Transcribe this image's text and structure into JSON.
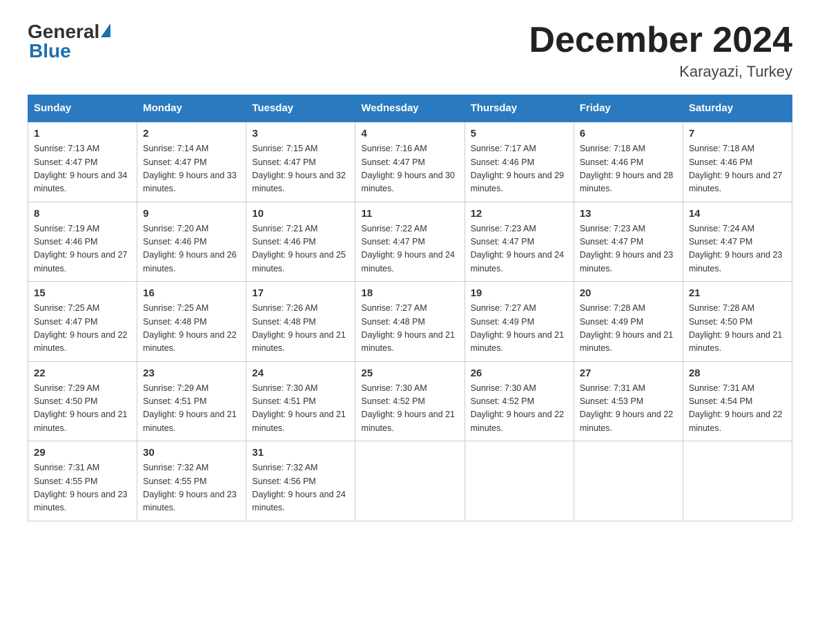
{
  "logo": {
    "general": "General",
    "blue": "Blue"
  },
  "title": "December 2024",
  "location": "Karayazi, Turkey",
  "days_of_week": [
    "Sunday",
    "Monday",
    "Tuesday",
    "Wednesday",
    "Thursday",
    "Friday",
    "Saturday"
  ],
  "weeks": [
    [
      {
        "day": "1",
        "sunrise": "7:13 AM",
        "sunset": "4:47 PM",
        "daylight": "9 hours and 34 minutes."
      },
      {
        "day": "2",
        "sunrise": "7:14 AM",
        "sunset": "4:47 PM",
        "daylight": "9 hours and 33 minutes."
      },
      {
        "day": "3",
        "sunrise": "7:15 AM",
        "sunset": "4:47 PM",
        "daylight": "9 hours and 32 minutes."
      },
      {
        "day": "4",
        "sunrise": "7:16 AM",
        "sunset": "4:47 PM",
        "daylight": "9 hours and 30 minutes."
      },
      {
        "day": "5",
        "sunrise": "7:17 AM",
        "sunset": "4:46 PM",
        "daylight": "9 hours and 29 minutes."
      },
      {
        "day": "6",
        "sunrise": "7:18 AM",
        "sunset": "4:46 PM",
        "daylight": "9 hours and 28 minutes."
      },
      {
        "day": "7",
        "sunrise": "7:18 AM",
        "sunset": "4:46 PM",
        "daylight": "9 hours and 27 minutes."
      }
    ],
    [
      {
        "day": "8",
        "sunrise": "7:19 AM",
        "sunset": "4:46 PM",
        "daylight": "9 hours and 27 minutes."
      },
      {
        "day": "9",
        "sunrise": "7:20 AM",
        "sunset": "4:46 PM",
        "daylight": "9 hours and 26 minutes."
      },
      {
        "day": "10",
        "sunrise": "7:21 AM",
        "sunset": "4:46 PM",
        "daylight": "9 hours and 25 minutes."
      },
      {
        "day": "11",
        "sunrise": "7:22 AM",
        "sunset": "4:47 PM",
        "daylight": "9 hours and 24 minutes."
      },
      {
        "day": "12",
        "sunrise": "7:23 AM",
        "sunset": "4:47 PM",
        "daylight": "9 hours and 24 minutes."
      },
      {
        "day": "13",
        "sunrise": "7:23 AM",
        "sunset": "4:47 PM",
        "daylight": "9 hours and 23 minutes."
      },
      {
        "day": "14",
        "sunrise": "7:24 AM",
        "sunset": "4:47 PM",
        "daylight": "9 hours and 23 minutes."
      }
    ],
    [
      {
        "day": "15",
        "sunrise": "7:25 AM",
        "sunset": "4:47 PM",
        "daylight": "9 hours and 22 minutes."
      },
      {
        "day": "16",
        "sunrise": "7:25 AM",
        "sunset": "4:48 PM",
        "daylight": "9 hours and 22 minutes."
      },
      {
        "day": "17",
        "sunrise": "7:26 AM",
        "sunset": "4:48 PM",
        "daylight": "9 hours and 21 minutes."
      },
      {
        "day": "18",
        "sunrise": "7:27 AM",
        "sunset": "4:48 PM",
        "daylight": "9 hours and 21 minutes."
      },
      {
        "day": "19",
        "sunrise": "7:27 AM",
        "sunset": "4:49 PM",
        "daylight": "9 hours and 21 minutes."
      },
      {
        "day": "20",
        "sunrise": "7:28 AM",
        "sunset": "4:49 PM",
        "daylight": "9 hours and 21 minutes."
      },
      {
        "day": "21",
        "sunrise": "7:28 AM",
        "sunset": "4:50 PM",
        "daylight": "9 hours and 21 minutes."
      }
    ],
    [
      {
        "day": "22",
        "sunrise": "7:29 AM",
        "sunset": "4:50 PM",
        "daylight": "9 hours and 21 minutes."
      },
      {
        "day": "23",
        "sunrise": "7:29 AM",
        "sunset": "4:51 PM",
        "daylight": "9 hours and 21 minutes."
      },
      {
        "day": "24",
        "sunrise": "7:30 AM",
        "sunset": "4:51 PM",
        "daylight": "9 hours and 21 minutes."
      },
      {
        "day": "25",
        "sunrise": "7:30 AM",
        "sunset": "4:52 PM",
        "daylight": "9 hours and 21 minutes."
      },
      {
        "day": "26",
        "sunrise": "7:30 AM",
        "sunset": "4:52 PM",
        "daylight": "9 hours and 22 minutes."
      },
      {
        "day": "27",
        "sunrise": "7:31 AM",
        "sunset": "4:53 PM",
        "daylight": "9 hours and 22 minutes."
      },
      {
        "day": "28",
        "sunrise": "7:31 AM",
        "sunset": "4:54 PM",
        "daylight": "9 hours and 22 minutes."
      }
    ],
    [
      {
        "day": "29",
        "sunrise": "7:31 AM",
        "sunset": "4:55 PM",
        "daylight": "9 hours and 23 minutes."
      },
      {
        "day": "30",
        "sunrise": "7:32 AM",
        "sunset": "4:55 PM",
        "daylight": "9 hours and 23 minutes."
      },
      {
        "day": "31",
        "sunrise": "7:32 AM",
        "sunset": "4:56 PM",
        "daylight": "9 hours and 24 minutes."
      },
      null,
      null,
      null,
      null
    ]
  ]
}
